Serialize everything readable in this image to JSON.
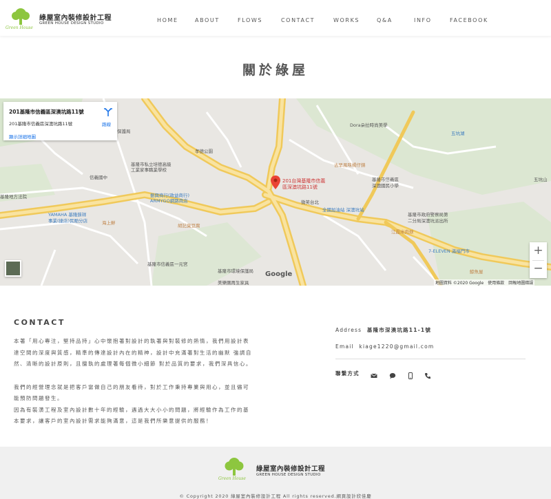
{
  "header": {
    "brand_cn": "綠屋室內裝修設計工程",
    "brand_en": "GREEN HOUSE DESIGN STUDIO",
    "logo_text": "Green House",
    "nav": [
      "HOME",
      "ABOUT",
      "FLOWS",
      "CONTACT",
      "WORKS",
      "Q&A",
      "INFO",
      "FACEBOOK"
    ]
  },
  "page_title": "關於綠屋",
  "map": {
    "card_address": "201基隆市信義區深澳坑路11號",
    "card_address2": "201基隆市信義區深澳坑路11號",
    "card_details": "顯示詳細地圖",
    "card_directions": "路線",
    "pin_label_1": "201台灣基隆市信義",
    "pin_label_2": "區深澳坑路11號",
    "google": "Google",
    "footer": "地圖資料 ©2020 Google　使用條款　回報地圖錯誤",
    "zoom_in": "+",
    "zoom_out": "−",
    "labels": {
      "l1": "Dora朵拉時尚美學",
      "l2": "五坑湖",
      "l3": "保護局",
      "l4": "孝德公園",
      "l5": "基隆市私立培德高級",
      "l6": "工業家事職業學校",
      "l7": "信義國中",
      "l8": "振興商行(政益商行)",
      "l9": "ARMYGO網路商店",
      "l10": "古早風味楊仔錦",
      "l11": "基隆市信義區",
      "l12": "深澳國民小學",
      "l13": "五坑山",
      "l14": "基隆地方法院",
      "l15": "YAMAHA 基隆錸祥",
      "l16": "事業(捷店)民勛分店",
      "l17": "海上鮮",
      "l18": "胡記臭豆腐",
      "l19": "微笑台北",
      "l20": "全國加油站 深澳坑站",
      "l21": "基隆市政府警察局第",
      "l22": "二分局深澳坑派出所",
      "l23": "江霞米肉焿",
      "l24": "7-ELEVEN 滿福門市",
      "l25": "基隆市信義區一元宮",
      "l26": "基隆市環境保護局",
      "l27": "美樂團再生家具",
      "l28": "鯨魚屋",
      "road1": "基隆市東東海外環道路",
      "road2": "62"
    }
  },
  "contact": {
    "title": "CONTACT",
    "paragraphs": [
      "本著「用心專注，堅持品持」心中懷抱著對設計的執著與對裝修的熱情，我們用設計表",
      "達空間的深度與質感，精準的傳達設計內在的精神，設計中充滿著對生活的幽默 強調自",
      "然、清晰的設計原則，且擅執的處理著每個微小細節 對於品質的要求，我們深具信心。",
      "我們的經營理念就是把客戶當做自己的朋友看待，對於工作秉持專業與用心，並且儘可",
      "能預防問題發生。",
      "因為有裝潢工程及室內設計數十年的經驗，遇過大大小小的問題，將經驗作為工作的基",
      "本要求，讓客戶的室內設計需求能夠滿意，這是我們所樂意提供的服務！"
    ],
    "address_label": "Address",
    "address_value": "基隆市深澳坑路11-1號",
    "email_label": "Email",
    "email_value": "kiage1220@gmail.com",
    "contact_ways": "聯繫方式"
  },
  "footer": {
    "brand_cn": "綠屋室內裝修設計工程",
    "brand_en": "GREEN HOUSE DESIGN STUDIO",
    "logo_text": "Green House",
    "copyright": "© Copyright 2020 綠屋室內裝修設計工程 All rights reserved.網頁設計欣佳慶"
  },
  "colors": {
    "brand_green": "#8dc63f",
    "map_road_yellow": "#f7d77a",
    "map_pin": "#ea4335"
  }
}
